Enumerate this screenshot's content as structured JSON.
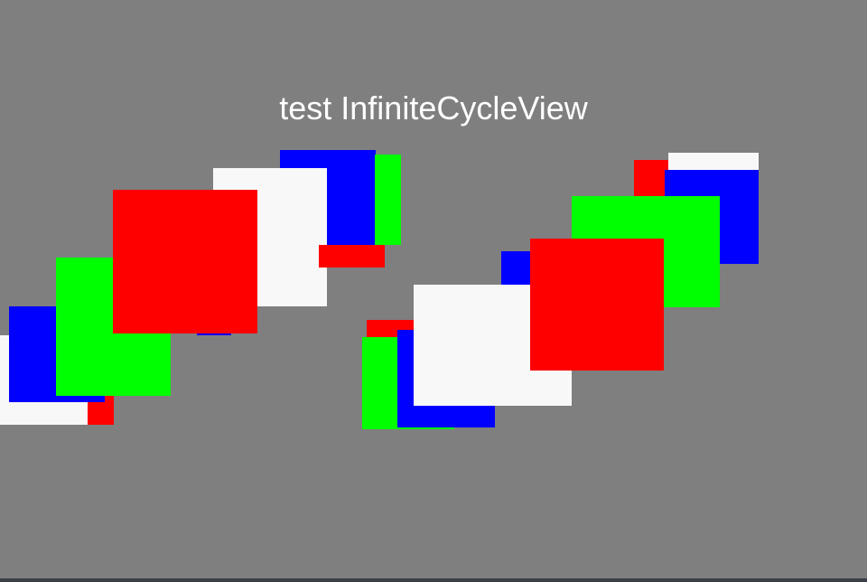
{
  "title": "test InfiniteCycleView",
  "colors": {
    "background": "#7f7f7f",
    "red": "#ff0000",
    "green": "#00ff00",
    "blue": "#0000ff",
    "white": "#f8f8f8"
  },
  "cycle_views": [
    {
      "name": "left-cycle-view",
      "items": [
        {
          "name": "white-card",
          "color": "white"
        },
        {
          "name": "red-card",
          "color": "red"
        },
        {
          "name": "blue-card",
          "color": "blue"
        },
        {
          "name": "green-card",
          "color": "green"
        },
        {
          "name": "red-card",
          "color": "red"
        },
        {
          "name": "blue-card",
          "color": "blue"
        },
        {
          "name": "green-card",
          "color": "green"
        },
        {
          "name": "white-card",
          "color": "white"
        },
        {
          "name": "red-card",
          "color": "red"
        }
      ]
    },
    {
      "name": "right-cycle-view",
      "items": [
        {
          "name": "white-card",
          "color": "white"
        },
        {
          "name": "red-card",
          "color": "red"
        },
        {
          "name": "blue-card",
          "color": "blue"
        },
        {
          "name": "green-card",
          "color": "green"
        },
        {
          "name": "red-card",
          "color": "red"
        },
        {
          "name": "green-card",
          "color": "green"
        },
        {
          "name": "blue-card",
          "color": "blue"
        },
        {
          "name": "white-card",
          "color": "white"
        },
        {
          "name": "red-card",
          "color": "red"
        }
      ]
    }
  ]
}
